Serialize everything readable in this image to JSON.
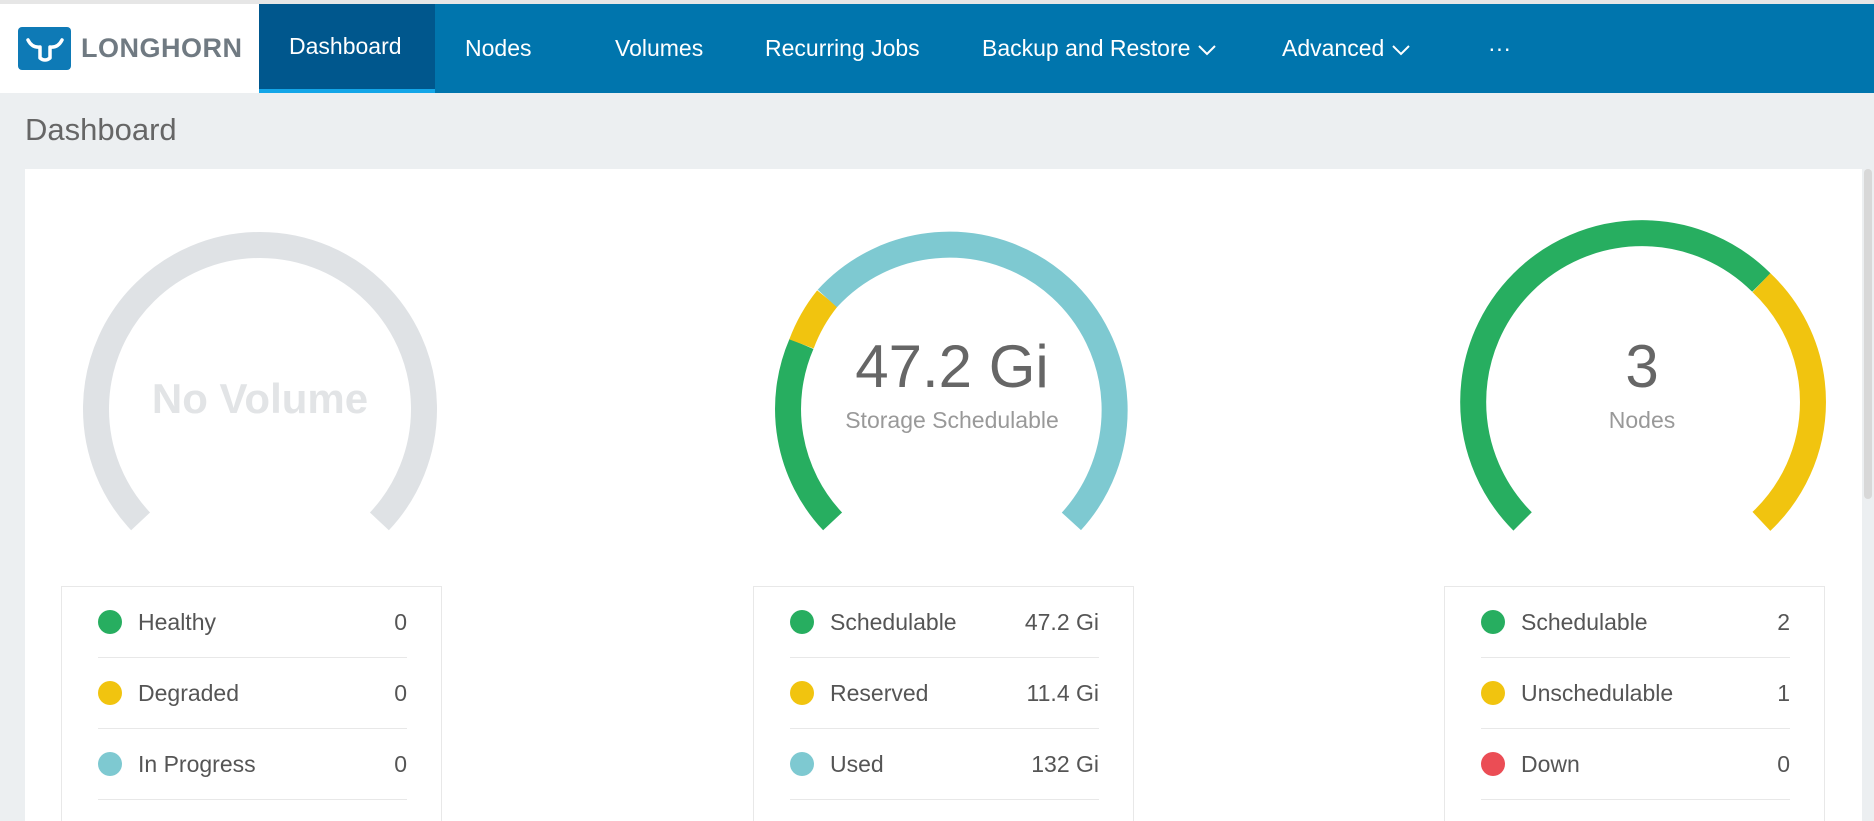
{
  "app": {
    "logo_text": "LONGHORN"
  },
  "nav": {
    "items": [
      {
        "label": "Dashboard",
        "active": true
      },
      {
        "label": "Nodes"
      },
      {
        "label": "Volumes"
      },
      {
        "label": "Recurring Jobs"
      },
      {
        "label": "Backup and Restore",
        "dropdown": true
      },
      {
        "label": "Advanced",
        "dropdown": true
      },
      {
        "label": "···"
      }
    ]
  },
  "page": {
    "title": "Dashboard"
  },
  "colors": {
    "green": "#27ae60",
    "yellow": "#f1c40f",
    "teal": "#7ec9d1",
    "red": "#eb4d55",
    "empty": "#dfe2e5",
    "nav_bg": "#0075ad",
    "nav_active": "#00578d"
  },
  "volumes": {
    "center_text": "No Volume",
    "legend": [
      {
        "label": "Healthy",
        "value": "0",
        "color": "#27ae60"
      },
      {
        "label": "Degraded",
        "value": "0",
        "color": "#f1c40f"
      },
      {
        "label": "In Progress",
        "value": "0",
        "color": "#7ec9d1"
      }
    ]
  },
  "storage": {
    "center_value": "47.2 Gi",
    "center_label": "Storage Schedulable",
    "legend": [
      {
        "label": "Schedulable",
        "value": "47.2 Gi",
        "color": "#27ae60"
      },
      {
        "label": "Reserved",
        "value": "11.4 Gi",
        "color": "#f1c40f"
      },
      {
        "label": "Used",
        "value": "132 Gi",
        "color": "#7ec9d1"
      }
    ]
  },
  "nodes": {
    "center_value": "3",
    "center_label": "Nodes",
    "legend": [
      {
        "label": "Schedulable",
        "value": "2",
        "color": "#27ae60"
      },
      {
        "label": "Unschedulable",
        "value": "1",
        "color": "#f1c40f"
      },
      {
        "label": "Down",
        "value": "0",
        "color": "#eb4d55"
      }
    ]
  }
}
